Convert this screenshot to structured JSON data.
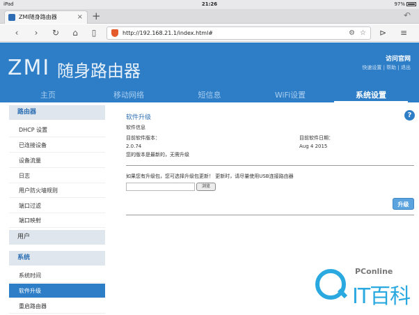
{
  "status_bar": {
    "device": "iPad",
    "time": "21:26",
    "battery": "97%"
  },
  "browser": {
    "tab_title": "ZMI随身路由器",
    "new_tab": "+",
    "url": "http://192.168.21.1/index.html#",
    "icons": [
      "back-icon",
      "forward-icon",
      "reload-icon",
      "home-icon",
      "bookmarks-icon",
      "shield-icon",
      "settings-icon",
      "star-icon",
      "play-icon",
      "menu-icon"
    ]
  },
  "header": {
    "logo_en": "ZMI",
    "logo_cn": "随身路由器",
    "visit_site": "访问官网",
    "quick_links": "快速设置 | 帮助 | 退出",
    "brand_color": "#2e7ec7"
  },
  "nav": {
    "items": [
      {
        "label": "主页"
      },
      {
        "label": "移动网络"
      },
      {
        "label": "短信息"
      },
      {
        "label": "WiFi设置"
      },
      {
        "label": "系统设置"
      }
    ],
    "active": "系统设置"
  },
  "sidebar": {
    "router_section": "路由器",
    "router_items": [
      "DHCP 设置",
      "已连接设备",
      "设备流量",
      "日志",
      "用户防火墙规则",
      "端口过滤",
      "端口映射"
    ],
    "user_section": "用户",
    "system_section": "系统",
    "system_items": [
      "系统时间",
      "软件升级",
      "重启路由器"
    ],
    "active": "软件升级"
  },
  "main": {
    "title": "软件升级",
    "info_heading": "软件信息",
    "current_version_label": "目前软件版本：",
    "current_date_label": "目前软件日期：",
    "version": "2.0.74",
    "date": "Aug 4 2015",
    "latest_note": "您的版本是最新的，无需升级",
    "upgrade_hint": "如果您有升级包，您可选择升级包更新！ 更新时，请尽量使用USB连接路由器",
    "browse_label": "浏览",
    "upgrade_button": "升级"
  },
  "watermark": {
    "small": "PConline",
    "big": "IT百科"
  }
}
